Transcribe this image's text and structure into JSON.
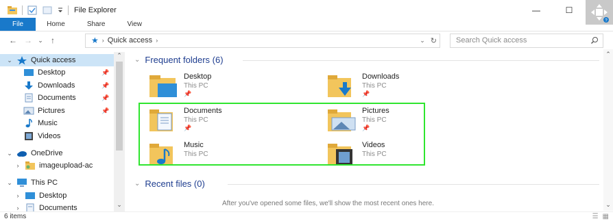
{
  "window": {
    "title": "File Explorer",
    "minimize_label": "—",
    "maximize_label": "☐"
  },
  "ribbon": {
    "tabs": [
      {
        "label": "File"
      },
      {
        "label": "Home"
      },
      {
        "label": "Share"
      },
      {
        "label": "View"
      }
    ]
  },
  "address": {
    "breadcrumb": [
      "Quick access"
    ],
    "search_placeholder": "Search Quick access"
  },
  "navpane": {
    "items": [
      {
        "label": "Quick access",
        "icon": "star-icon"
      },
      {
        "label": "Desktop",
        "icon": "desktop-folder-icon"
      },
      {
        "label": "Downloads",
        "icon": "download-arrow-icon"
      },
      {
        "label": "Documents",
        "icon": "document-icon"
      },
      {
        "label": "Pictures",
        "icon": "pictures-icon"
      },
      {
        "label": "Music",
        "icon": "music-note-icon"
      },
      {
        "label": "Videos",
        "icon": "videos-icon"
      },
      {
        "label": "OneDrive",
        "icon": "cloud-icon"
      },
      {
        "label": "imageupload-ac",
        "icon": "folder-icon"
      },
      {
        "label": "This PC",
        "icon": "computer-icon"
      },
      {
        "label": "Desktop",
        "icon": "desktop-folder-icon"
      },
      {
        "label": "Documents",
        "icon": "document-icon"
      }
    ]
  },
  "content": {
    "frequent_header": "Frequent folders (6)",
    "folders": [
      {
        "name": "Desktop",
        "location": "This PC",
        "icon": "desktop-folder-icon"
      },
      {
        "name": "Downloads",
        "location": "This PC",
        "icon": "downloads-folder-icon"
      },
      {
        "name": "Documents",
        "location": "This PC",
        "icon": "documents-folder-icon"
      },
      {
        "name": "Pictures",
        "location": "This PC",
        "icon": "pictures-folder-icon"
      },
      {
        "name": "Music",
        "location": "This PC",
        "icon": "music-folder-icon"
      },
      {
        "name": "Videos",
        "location": "This PC",
        "icon": "videos-folder-icon"
      }
    ],
    "recent_header": "Recent files (0)",
    "recent_empty_message": "After you've opened some files, we'll show the most recent ones here."
  },
  "status": {
    "item_count": "6 items"
  },
  "colors": {
    "accent": "#1979ca",
    "selection": "#cce4f7",
    "folder_yellow": "#f2c55c",
    "highlight_box": "#2ee52e"
  }
}
